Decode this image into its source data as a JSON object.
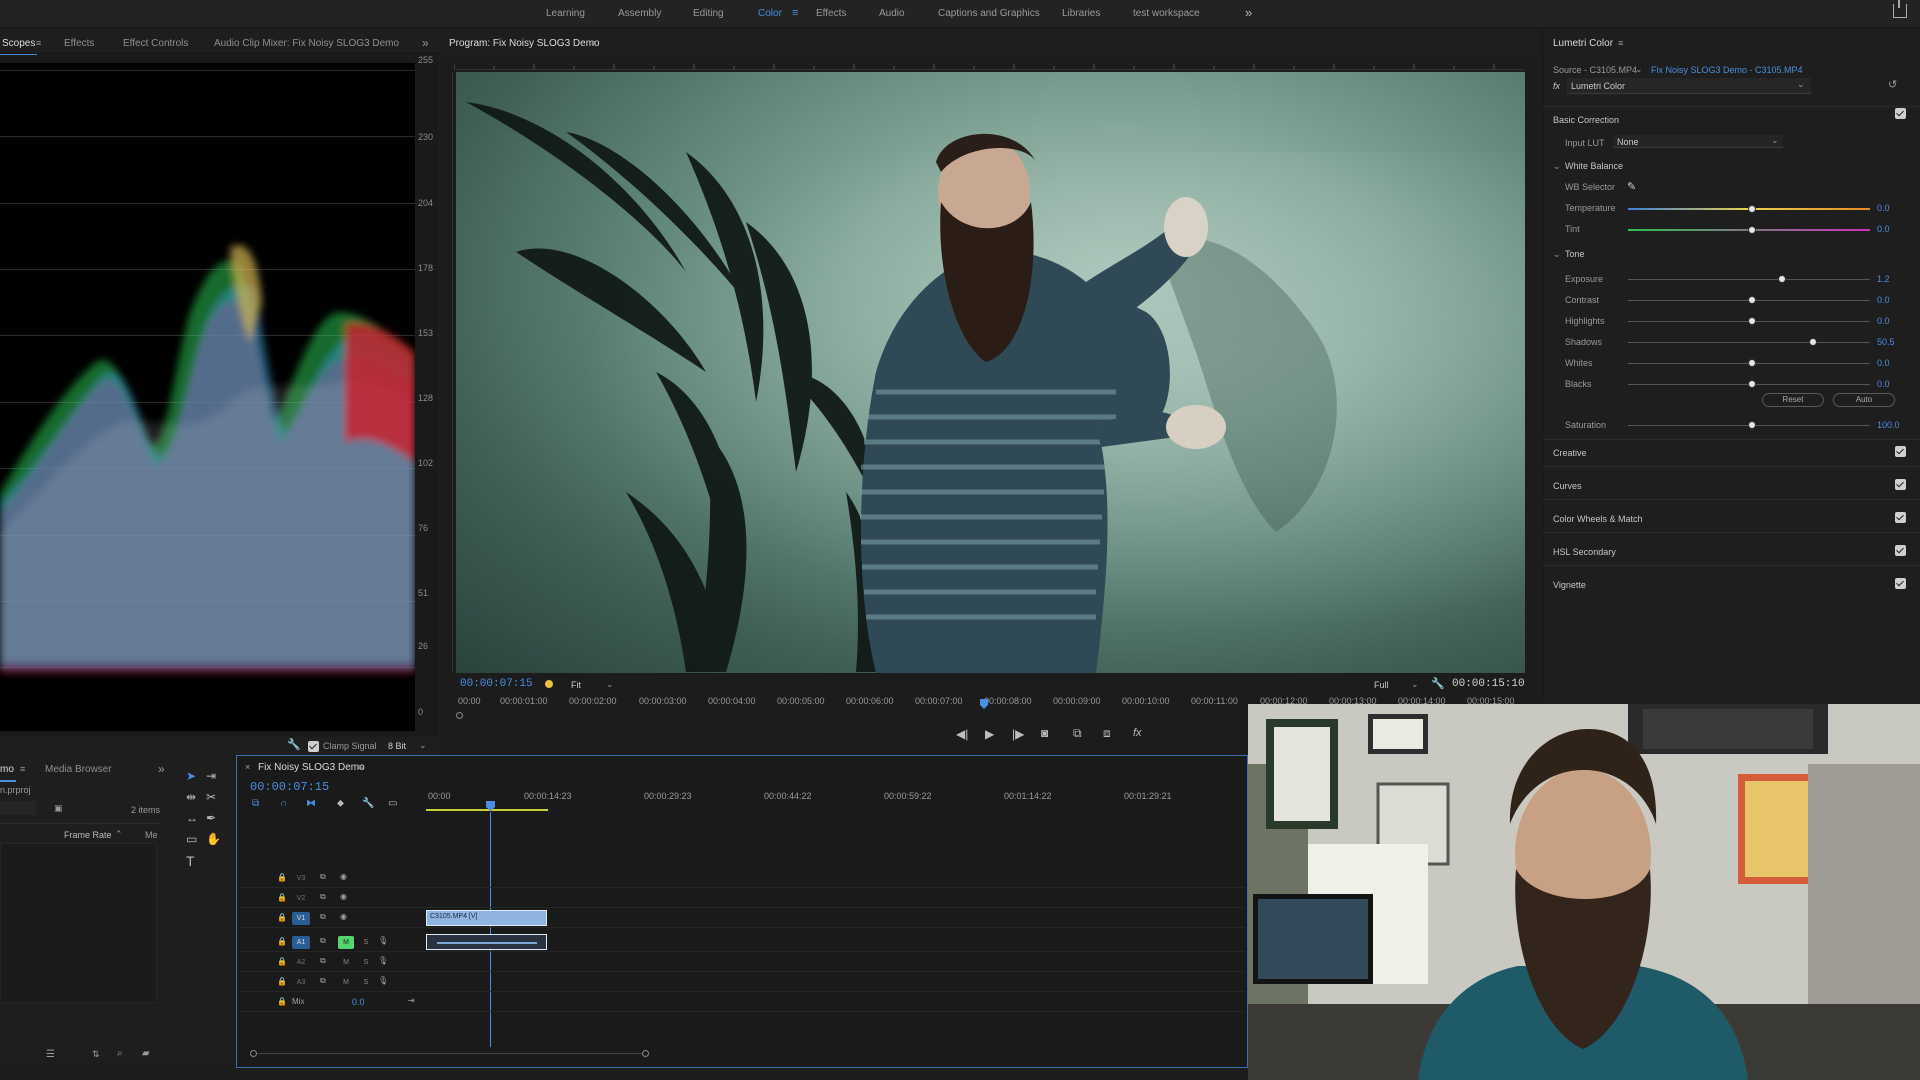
{
  "workspaces": {
    "items": [
      "Learning",
      "Assembly",
      "Editing",
      "Color",
      "Effects",
      "Audio",
      "Captions and Graphics",
      "Libraries",
      "test workspace"
    ],
    "active": "Color"
  },
  "left_panel": {
    "tabs": [
      "Scopes",
      "Effects",
      "Effect Controls",
      "Audio Clip Mixer: Fix Noisy SLOG3 Demo"
    ],
    "scale": [
      "255",
      "230",
      "204",
      "178",
      "153",
      "128",
      "102",
      "76",
      "51",
      "26",
      "0"
    ],
    "clamp_label": "Clamp Signal",
    "bit_depth": "8 Bit"
  },
  "program": {
    "title": "Program: Fix Noisy SLOG3 Demo",
    "timecode_current": "00:00:07:15",
    "fit": "Fit",
    "quality": "Full",
    "timecode_duration": "00:00:15:10",
    "ruler_marks": [
      "00:00",
      "00:00:01:00",
      "00:00:02:00",
      "00:00:03:00",
      "00:00:04:00",
      "00:00:05:00",
      "00:00:06:00",
      "00:00:07:00",
      "00:00:08:00",
      "00:00:09:00",
      "00:00:10:00",
      "00:00:11:00",
      "00:00:12:00",
      "00:00:13:00",
      "00:00:14:00",
      "00:00:15:00"
    ]
  },
  "lumetri": {
    "title": "Lumetri Color",
    "source": "Source - C3105.MP4",
    "clip": "Fix Noisy SLOG3 Demo - C3105.MP4",
    "fx_name": "Lumetri Color",
    "basic_correction": "Basic Correction",
    "input_lut_label": "Input LUT",
    "input_lut_value": "None",
    "white_balance": "White Balance",
    "wb_selector": "WB Selector",
    "tone": "Tone",
    "sliders": [
      {
        "name": "Temperature",
        "value": "0.0",
        "pos": 0.5
      },
      {
        "name": "Tint",
        "value": "0.0",
        "pos": 0.5
      },
      {
        "name": "Exposure",
        "value": "1.2",
        "pos": 0.63
      },
      {
        "name": "Contrast",
        "value": "0.0",
        "pos": 0.5
      },
      {
        "name": "Highlights",
        "value": "0.0",
        "pos": 0.5
      },
      {
        "name": "Shadows",
        "value": "50.5",
        "pos": 0.76
      },
      {
        "name": "Whites",
        "value": "0.0",
        "pos": 0.5
      },
      {
        "name": "Blacks",
        "value": "0.0",
        "pos": 0.5
      }
    ],
    "reset": "Reset",
    "auto": "Auto",
    "saturation": {
      "name": "Saturation",
      "value": "100.0",
      "pos": 0.5
    },
    "sections": [
      "Creative",
      "Curves",
      "Color Wheels & Match",
      "HSL Secondary",
      "Vignette"
    ]
  },
  "project": {
    "tabs": [
      "mo",
      "Media Browser"
    ],
    "file": "n.prproj",
    "items": "2 items",
    "column": "Frame Rate",
    "column2": "Me"
  },
  "timeline": {
    "title": "Fix Noisy SLOG3 Demo",
    "timecode": "00:00:07:15",
    "ruler": [
      "00:00",
      "00:00:14:23",
      "00:00:29:23",
      "00:00:44:22",
      "00:00:59:22",
      "00:01:14:22",
      "00:01:29:21"
    ],
    "video_tracks": [
      "V3",
      "V2",
      "V1"
    ],
    "audio_tracks": [
      "A1",
      "A2",
      "A3"
    ],
    "mix_label": "Mix",
    "mix_value": "0.0",
    "clip_video": "C3105.MP4 [V]"
  },
  "colors": {
    "accent": "#4a8fe0",
    "panel": "#1e1e1e",
    "clip_video": "#8fb4e0",
    "solo_on": "#52d76b"
  }
}
